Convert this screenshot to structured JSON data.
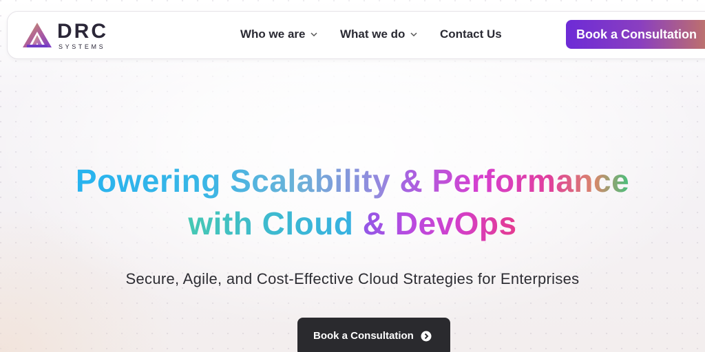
{
  "brand": {
    "name": "DRC",
    "tagline": "SYSTEMS"
  },
  "nav": {
    "items": [
      {
        "label": "Who we are",
        "has_dropdown": true,
        "icon": "chevron-down-icon"
      },
      {
        "label": "What we do",
        "has_dropdown": true,
        "icon": "chevron-down-icon"
      },
      {
        "label": "Contact Us",
        "has_dropdown": false
      }
    ],
    "cta_label": "Book a Consultation"
  },
  "hero": {
    "headline_line1": [
      "Powering Scalability",
      "& Performance"
    ],
    "headline_line2": [
      "with Cloud",
      "& DevOps"
    ],
    "subtitle": "Secure, Agile, and Cost-Effective Cloud Strategies for Enterprises",
    "cta_label": "Book a Consultation",
    "cta_icon": "arrow-right-circle-icon"
  },
  "colors": {
    "cta_gradient_start": "#6d2bd6",
    "cta_gradient_end": "#c78d55",
    "hero_button_bg": "#2a2a2e",
    "text_dark": "#2a2a33"
  }
}
